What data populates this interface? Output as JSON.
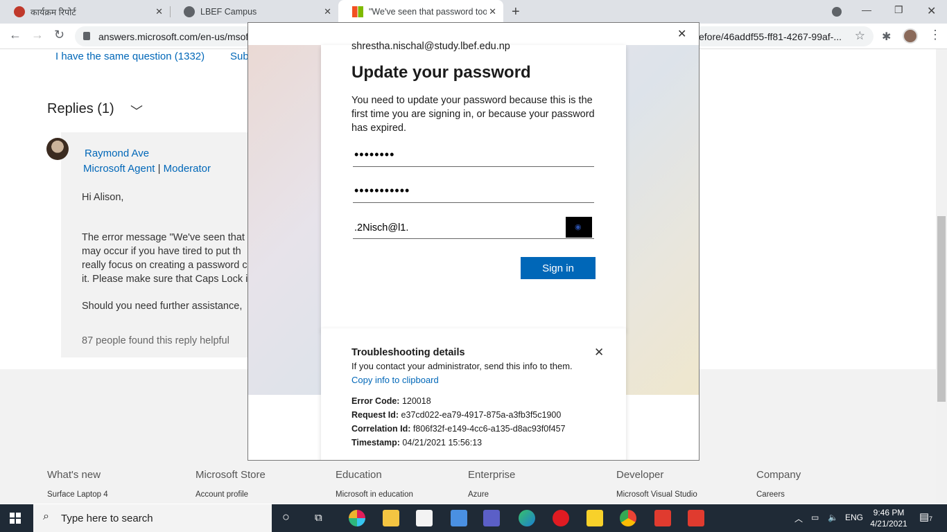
{
  "browser": {
    "tabs": [
      {
        "title": "कार्यक्रम रिपोर्ट",
        "icon": "nepal-emblem-icon"
      },
      {
        "title": "LBEF Campus",
        "icon": "globe-icon"
      },
      {
        "title": "\"We've seen that password too m",
        "icon": "microsoft-logo-icon"
      }
    ],
    "url": "answers.microsoft.com/en-us/msof",
    "url_tail": "efore/46addf55-ff81-4267-99af-..."
  },
  "page": {
    "same_question": "I have the same question (1332)",
    "subscribe": "Sub",
    "replies_label": "Replies (1)",
    "reply": {
      "author": "Raymond Ave",
      "role": "Microsoft Agent",
      "role2": "Moderator",
      "greeting": "Hi Alison,",
      "lines": [
        "The error message \"We've seen that",
        "may occur if you have tired to put th",
        "really focus on creating a password c",
        "it. Please make sure that Caps Lock i"
      ],
      "further": "Should you need further assistance,",
      "helpful": "87 people found this reply helpful"
    },
    "footer": {
      "columns": [
        "What's new",
        "Microsoft Store",
        "Education",
        "Enterprise",
        "Developer",
        "Company"
      ],
      "links": [
        "Surface Laptop 4",
        "Account profile",
        "Microsoft in education",
        "Azure",
        "Microsoft Visual Studio",
        "Careers"
      ]
    }
  },
  "modal": {
    "email": "shrestha.nischal@study.lbef.edu.np",
    "title": "Update your password",
    "description": "You need to update your password because this is the first time you are signing in, or because your password has expired.",
    "current_password_mask": "••••••••",
    "new_password_mask": "•••••••••••",
    "confirm_password": ".2Nisch@l1.",
    "signin_label": "Sign in",
    "trouble": {
      "title": "Troubleshooting details",
      "subtitle": "If you contact your administrator, send this info to them.",
      "copy_link": "Copy info to clipboard",
      "error_code_label": "Error Code:",
      "error_code": "120018",
      "request_id_label": "Request Id:",
      "request_id": "e37cd022-ea79-4917-875a-a3fb3f5c1900",
      "correlation_id_label": "Correlation Id:",
      "correlation_id": "f806f32f-e149-4cc6-a135-d8ac93f0f457",
      "timestamp_label": "Timestamp:",
      "timestamp": "04/21/2021 15:56:13"
    }
  },
  "taskbar": {
    "search_placeholder": "Type here to search",
    "language": "ENG",
    "time": "9:46 PM",
    "date": "4/21/2021",
    "notification_count": "7"
  },
  "colors": {
    "accent": "#0067b8",
    "taskbar": "#1f2a36"
  }
}
